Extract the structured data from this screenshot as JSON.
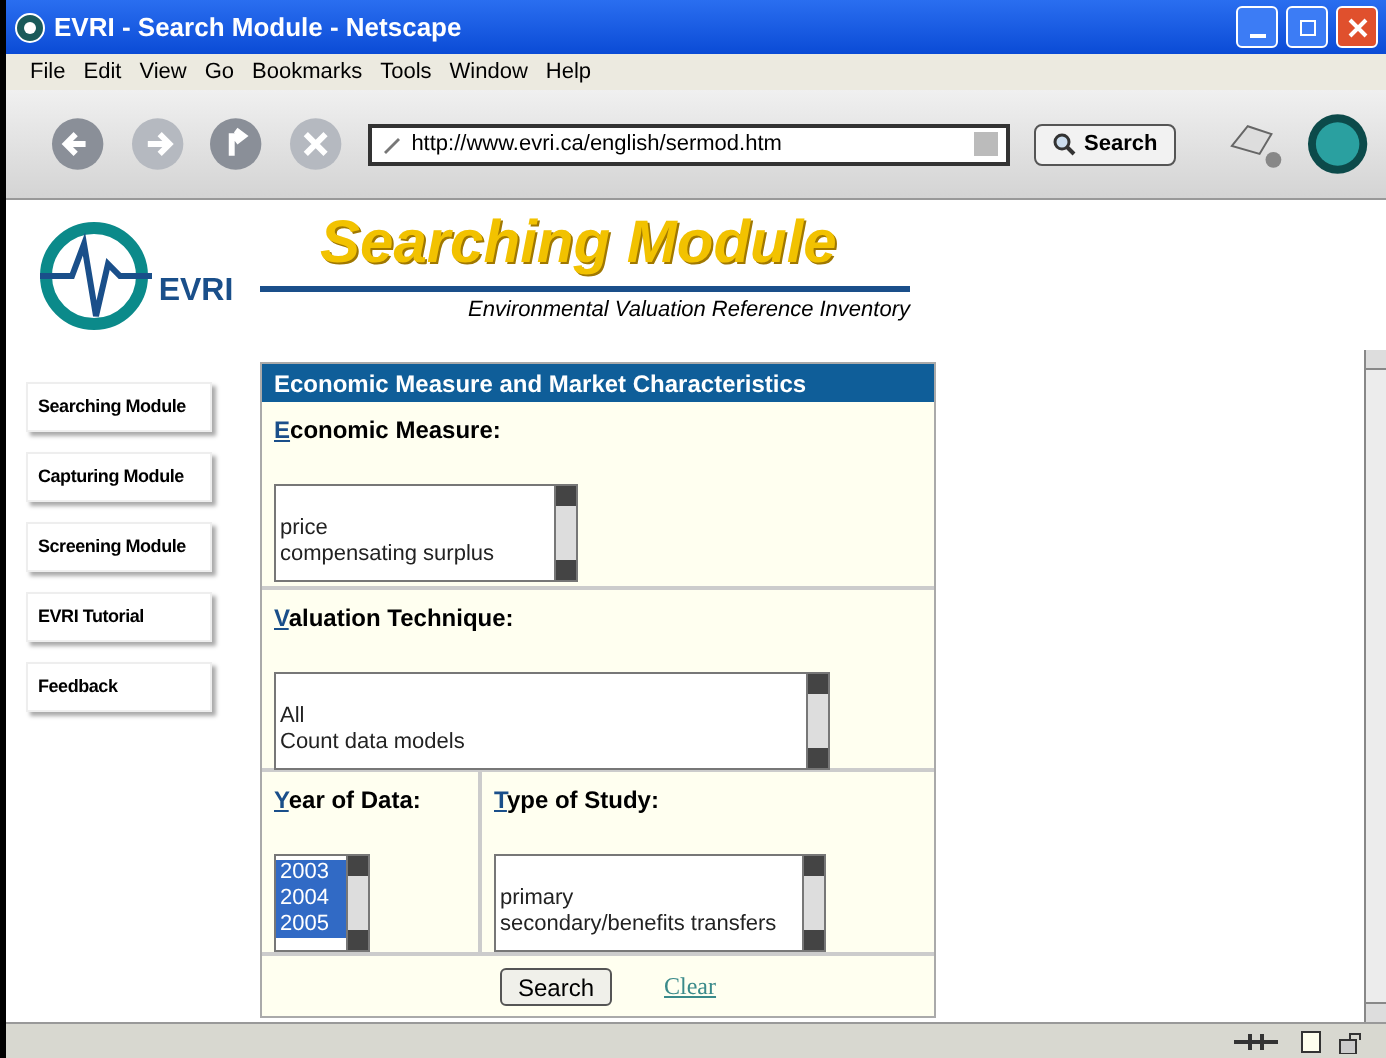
{
  "window": {
    "title": "EVRI - Search Module - Netscape"
  },
  "menu": [
    "File",
    "Edit",
    "View",
    "Go",
    "Bookmarks",
    "Tools",
    "Window",
    "Help"
  ],
  "toolbar": {
    "url": "http://www.evri.ca/english/sermod.htm",
    "search_button": "Search"
  },
  "logo": {
    "text": "EVRI"
  },
  "banner": {
    "title": "Searching Module",
    "subtitle": "Environmental Valuation Reference Inventory"
  },
  "sidebar": {
    "items": [
      {
        "label": "Searching Module"
      },
      {
        "label": "Capturing Module"
      },
      {
        "label": "Screening Module"
      },
      {
        "label": "EVRI Tutorial"
      },
      {
        "label": "Feedback"
      }
    ]
  },
  "form": {
    "header": "Economic Measure and Market Characteristics",
    "economic_measure": {
      "label": "Economic Measure:",
      "options": [
        {
          "text": "price",
          "selected": false
        },
        {
          "text": "compensating surplus",
          "selected": false
        }
      ]
    },
    "valuation_technique": {
      "label": "Valuation Technique:",
      "options": [
        {
          "text": "All",
          "selected": false
        },
        {
          "text": "Count data models",
          "selected": false
        }
      ]
    },
    "year_of_data": {
      "label": "Year of Data:",
      "options": [
        {
          "text": "2003",
          "selected": true
        },
        {
          "text": "2004",
          "selected": true
        },
        {
          "text": "2005",
          "selected": true
        }
      ]
    },
    "type_of_study": {
      "label": "Type of Study:",
      "options": [
        {
          "text": "primary",
          "selected": false
        },
        {
          "text": "secondary/benefits transfers",
          "selected": false
        }
      ]
    },
    "search_button": "Search",
    "clear_link": "Clear"
  }
}
